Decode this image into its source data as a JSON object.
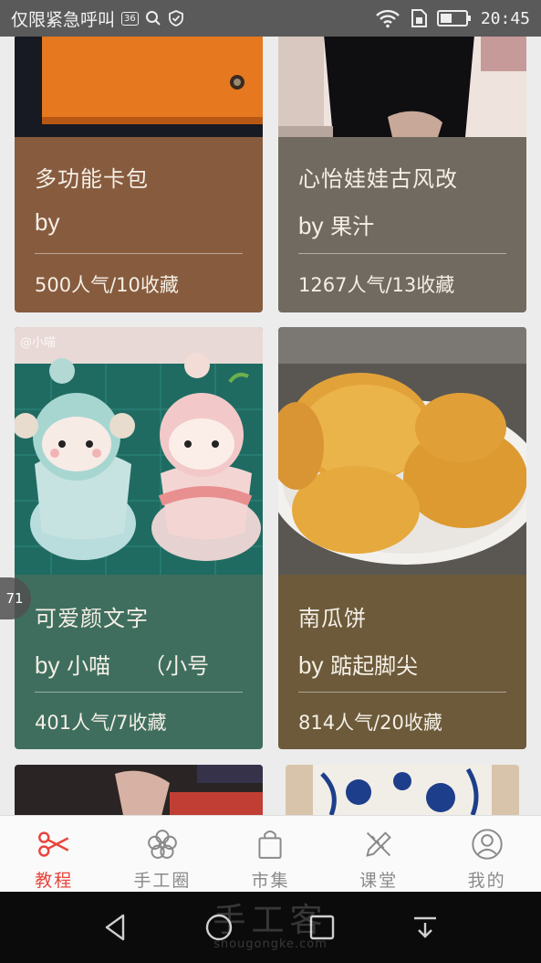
{
  "status_bar": {
    "carrier": "仅限紧急呼叫",
    "badge": "36",
    "time": "20:45"
  },
  "cards": [
    {
      "title": "多功能卡包",
      "author_prefix": "by",
      "author": "",
      "stats": "500人气/10收藏",
      "color": "#875b3e"
    },
    {
      "title": "心怡娃娃古风改",
      "author_prefix": "by",
      "author": "果汁",
      "stats": "1267人气/13收藏",
      "color": "#716a60"
    },
    {
      "title": "可爱颜文字",
      "author_prefix": "by",
      "author": "小喵　　（小号",
      "stats": "401人气/7收藏",
      "color": "#3f6e5e",
      "photo_watermark": "@小喵"
    },
    {
      "title": "南瓜饼",
      "author_prefix": "by",
      "author": "踮起脚尖",
      "stats": "814人气/20收藏",
      "color": "#6c5a3a"
    }
  ],
  "side_bubble": {
    "value": "71"
  },
  "tabs": [
    {
      "label": "教程",
      "icon": "scissors-icon",
      "active": true
    },
    {
      "label": "手工圈",
      "icon": "flower-icon",
      "active": false
    },
    {
      "label": "市集",
      "icon": "shopping-bag-icon",
      "active": false
    },
    {
      "label": "课堂",
      "icon": "pencil-ruler-icon",
      "active": false
    },
    {
      "label": "我的",
      "icon": "user-icon",
      "active": false
    }
  ],
  "nav_bar": {
    "buttons": [
      "back-icon",
      "home-icon",
      "recents-icon",
      "notification-pull-icon"
    ]
  },
  "watermark": {
    "main": "手工客",
    "sub": "shougongke.com"
  },
  "colors": {
    "accent": "#e8453c",
    "status_bar": "#5a5a5a"
  }
}
